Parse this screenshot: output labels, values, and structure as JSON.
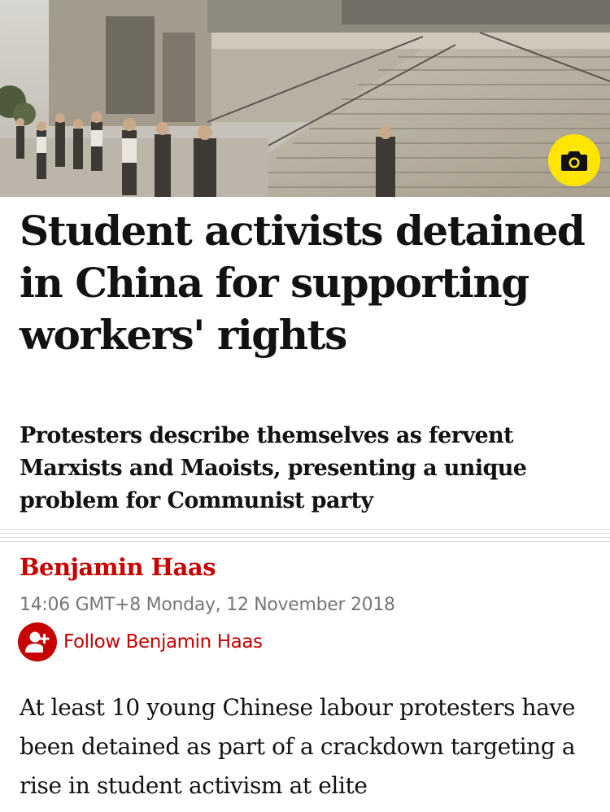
{
  "hero": {
    "image_alt": "People walking past a building with wide stone steps",
    "camera_icon": "camera-icon",
    "camera_button_color": "#ffe500"
  },
  "article": {
    "headline": "Student activists detained in China for supporting workers' rights",
    "standfirst": "Protesters describe themselves as fervent Marxists and Maoists, presenting a unique problem for Communist party",
    "byline": "Benjamin Haas",
    "timestamp": "14:06 GMT+8 Monday, 12 November 2018",
    "follow_label": "Follow Benjamin Haas",
    "follow_icon": "add-person-icon",
    "body": "At least 10 young Chinese labour protesters have been detained as part of a crackdown targeting a rise in student activism at elite"
  },
  "colors": {
    "accent": "#c70000",
    "text": "#121212",
    "meta": "#767676"
  }
}
